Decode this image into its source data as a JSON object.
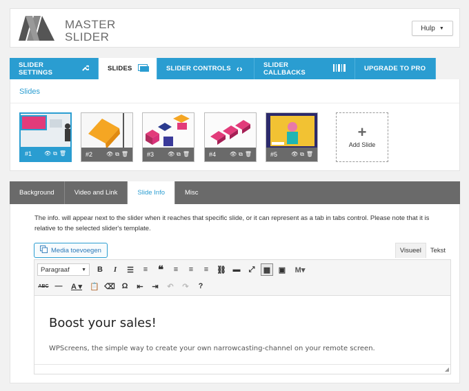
{
  "header": {
    "logo_top": "MASTER",
    "logo_bottom": "SLIDER",
    "help_label": "Hulp"
  },
  "main_tabs": [
    {
      "label": "SLIDER SETTINGS",
      "icon": "wrench-icon"
    },
    {
      "label": "SLIDES",
      "icon": "slides-icon"
    },
    {
      "label": "SLIDER CONTROLS",
      "icon": "arrows-icon"
    },
    {
      "label": "SLIDER CALLBACKS",
      "icon": "barcode-icon"
    },
    {
      "label": "UPGRADE TO PRO",
      "icon": ""
    }
  ],
  "slides_panel": {
    "title": "Slides",
    "slides": [
      {
        "number": "#1",
        "selected": true
      },
      {
        "number": "#2",
        "selected": false
      },
      {
        "number": "#3",
        "selected": false
      },
      {
        "number": "#4",
        "selected": false
      },
      {
        "number": "#5",
        "selected": false
      }
    ],
    "add_slide_label": "Add Slide"
  },
  "slide_tabs": [
    "Background",
    "Video and Link",
    "Slide Info",
    "Misc"
  ],
  "slide_info": {
    "description": "The info. will appear next to the slider when it reaches that specific slide, or it can represent as a tab in tabs control. Please note that it is relative to the selected slider's template.",
    "media_button": "Media toevoegen",
    "mode_visual": "Visueel",
    "mode_text": "Tekst",
    "format_select": "Paragraaf",
    "heading": "Boost your sales!",
    "paragraph": "WPScreens, the simple way to create your own narrowcasting-channel on your remote screen."
  },
  "colors": {
    "accent": "#2a9dd1",
    "dark_tab": "#6a6a6a"
  }
}
